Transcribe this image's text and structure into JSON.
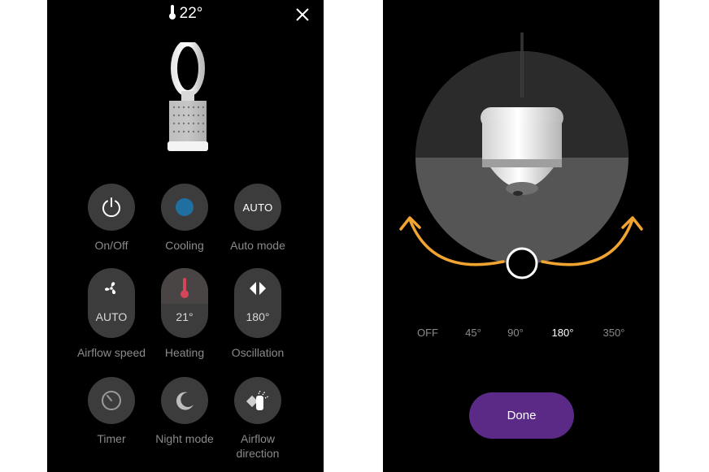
{
  "left_panel": {
    "temperature": "22°",
    "controls": {
      "on_off": {
        "label": "On/Off"
      },
      "cooling": {
        "label": "Cooling"
      },
      "auto_mode": {
        "label": "Auto mode",
        "value": "AUTO"
      },
      "airflow_speed": {
        "label": "Airflow speed",
        "value": "AUTO"
      },
      "heating": {
        "label": "Heating",
        "value": "21°"
      },
      "oscillation": {
        "label": "Oscillation",
        "value": "180°"
      },
      "timer": {
        "label": "Timer"
      },
      "night_mode": {
        "label": "Night mode"
      },
      "airflow_direction": {
        "label": "Airflow direction"
      }
    }
  },
  "right_panel": {
    "angles": [
      "OFF",
      "45°",
      "90°",
      "180°",
      "350°"
    ],
    "selected_angle": "180°",
    "done_label": "Done"
  },
  "colors": {
    "cooling_dot": "#1f6fa0",
    "heating_thermometer": "#d4455a",
    "arrow_orange": "#f2a431",
    "done_button": "#5a2a86"
  }
}
